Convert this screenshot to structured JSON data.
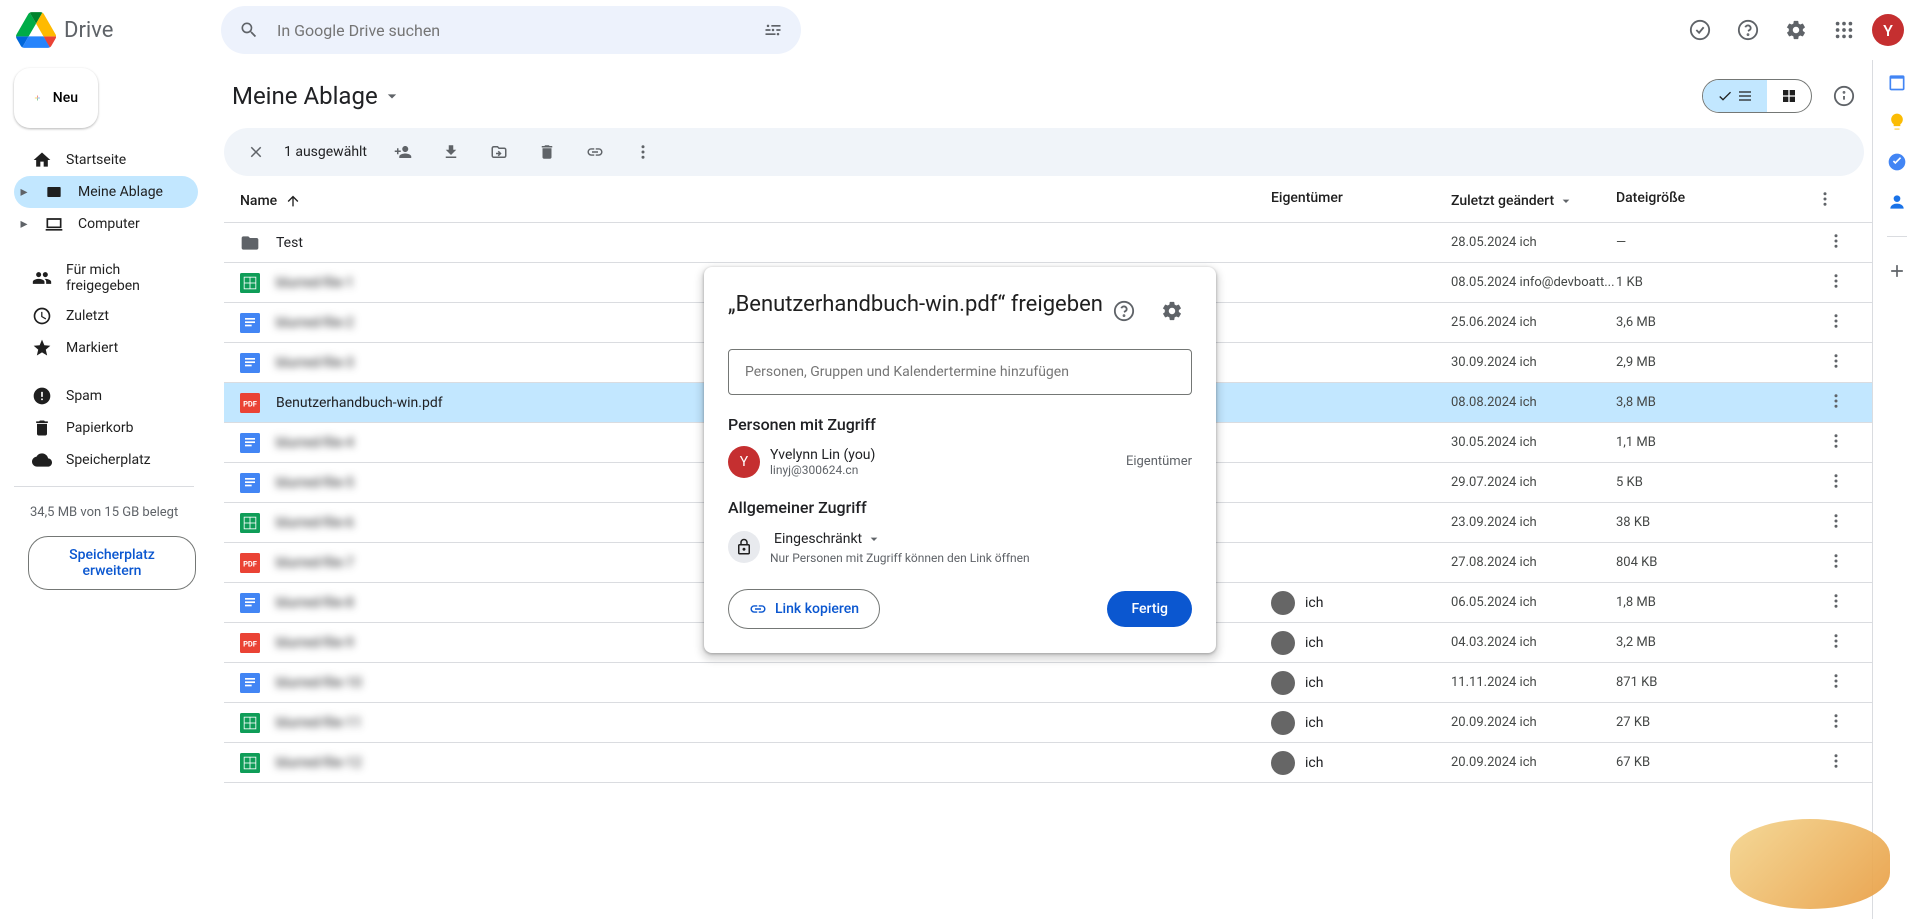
{
  "header": {
    "app_name": "Drive",
    "search_placeholder": "In Google Drive suchen",
    "avatar_initial": "Y"
  },
  "sidebar": {
    "new_label": "Neu",
    "items": [
      {
        "label": "Startseite",
        "icon": "home"
      },
      {
        "label": "Meine Ablage",
        "icon": "drive",
        "active": true,
        "expandable": true
      },
      {
        "label": "Computer",
        "icon": "devices",
        "expandable": true
      }
    ],
    "items2": [
      {
        "label": "Für mich freigegeben",
        "icon": "shared"
      },
      {
        "label": "Zuletzt",
        "icon": "clock"
      },
      {
        "label": "Markiert",
        "icon": "star"
      }
    ],
    "items3": [
      {
        "label": "Spam",
        "icon": "spam"
      },
      {
        "label": "Papierkorb",
        "icon": "trash"
      },
      {
        "label": "Speicherplatz",
        "icon": "cloud"
      }
    ],
    "storage_text": "34,5 MB von 15 GB belegt",
    "storage_btn": "Speicherplatz erweitern"
  },
  "content": {
    "breadcrumb": "Meine Ablage",
    "selected_text": "1 ausgewählt",
    "columns": {
      "name": "Name",
      "owner": "Eigentümer",
      "modified": "Zuletzt geändert",
      "size": "Dateigröße"
    }
  },
  "rows": [
    {
      "icon": "folder",
      "name": "Test",
      "owner": "",
      "modified": "28.05.2024 ich",
      "size": "—",
      "blurred": false
    },
    {
      "icon": "sheet",
      "name": "blurred-file-1",
      "owner": "",
      "modified": "08.05.2024 info@devboatt...",
      "size": "1 KB",
      "blurred": true
    },
    {
      "icon": "doc",
      "name": "blurred-file-2",
      "owner": "",
      "modified": "25.06.2024 ich",
      "size": "3,6 MB",
      "blurred": true
    },
    {
      "icon": "doc-blue",
      "name": "blurred-file-3",
      "owner": "",
      "modified": "30.09.2024 ich",
      "size": "2,9 MB",
      "blurred": true
    },
    {
      "icon": "pdf",
      "name": "Benutzerhandbuch-win.pdf",
      "owner": "",
      "modified": "08.08.2024 ich",
      "size": "3,8 MB",
      "blurred": false,
      "selected": true
    },
    {
      "icon": "doc-blue",
      "name": "blurred-file-4",
      "owner": "",
      "modified": "30.05.2024 ich",
      "size": "1,1 MB",
      "blurred": true
    },
    {
      "icon": "doc-blue",
      "name": "blurred-file-5",
      "owner": "",
      "modified": "29.07.2024 ich",
      "size": "5 KB",
      "blurred": true
    },
    {
      "icon": "sheet",
      "name": "blurred-file-6",
      "owner": "",
      "modified": "23.09.2024 ich",
      "size": "38 KB",
      "blurred": true
    },
    {
      "icon": "pdf",
      "name": "blurred-file-7",
      "owner": "",
      "modified": "27.08.2024 ich",
      "size": "804 KB",
      "blurred": true
    },
    {
      "icon": "doc",
      "name": "blurred-file-8",
      "owner": "ich",
      "modified": "06.05.2024 ich",
      "size": "1,8 MB",
      "blurred": true
    },
    {
      "icon": "pdf",
      "name": "blurred-file-9",
      "owner": "ich",
      "modified": "04.03.2024 ich",
      "size": "3,2 MB",
      "blurred": true
    },
    {
      "icon": "doc-blue",
      "name": "blurred-file-10",
      "owner": "ich",
      "modified": "11.11.2024 ich",
      "size": "871 KB",
      "blurred": true
    },
    {
      "icon": "sheet",
      "name": "blurred-file-11",
      "owner": "ich",
      "modified": "20.09.2024 ich",
      "size": "27 KB",
      "blurred": true
    },
    {
      "icon": "sheet",
      "name": "blurred-file-12",
      "owner": "ich",
      "modified": "20.09.2024 ich",
      "size": "67 KB",
      "blurred": true
    }
  ],
  "dialog": {
    "title": "„Benutzerhandbuch-win.pdf“ freigeben",
    "input_placeholder": "Personen, Gruppen und Kalendertermine hinzufügen",
    "people_section": "Personen mit Zugriff",
    "person_name": "Yvelynn Lin (you)",
    "person_email": "linyj@300624.cn",
    "person_role": "Eigentümer",
    "general_section": "Allgemeiner Zugriff",
    "access_label": "Eingeschränkt",
    "access_desc": "Nur Personen mit Zugriff können den Link öffnen",
    "copy_link": "Link kopieren",
    "done": "Fertig",
    "avatar_initial": "Y"
  }
}
